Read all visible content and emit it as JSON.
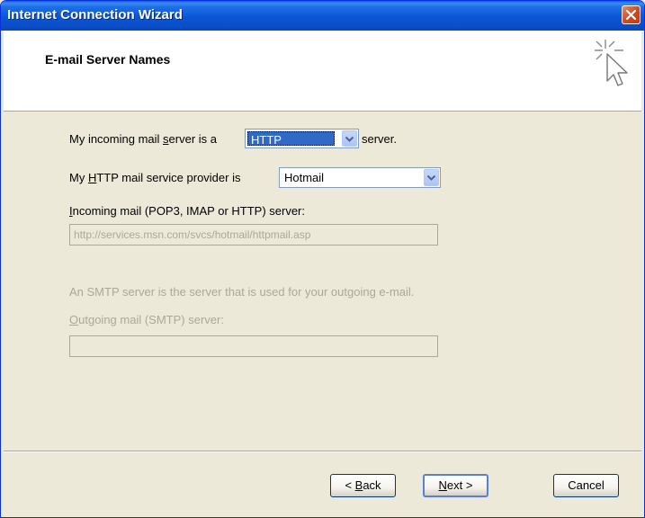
{
  "window": {
    "title": "Internet Connection Wizard"
  },
  "header": {
    "title": "E-mail Server Names"
  },
  "incoming_type": {
    "label_pre": "My incoming mail ",
    "label_ul": "s",
    "label_post": "erver is a",
    "value": "HTTP",
    "suffix": "server."
  },
  "provider": {
    "label_pre": "My ",
    "label_ul": "H",
    "label_post": "TTP mail service provider is",
    "value": "Hotmail"
  },
  "incoming_server": {
    "label_ul": "I",
    "label_post": "ncoming mail (POP3, IMAP or HTTP) server:",
    "value": "http://services.msn.com/svcs/hotmail/httpmail.asp"
  },
  "smtp_note": "An SMTP server is the server that is used for your outgoing e-mail.",
  "outgoing_server": {
    "label_ul": "O",
    "label_post": "utgoing mail (SMTP) server:",
    "value": ""
  },
  "buttons": {
    "back_pre": "< ",
    "back_ul": "B",
    "back_post": "ack",
    "next_ul": "N",
    "next_post": "ext >",
    "cancel": "Cancel"
  },
  "colors": {
    "titlebar": "#0b55d6",
    "close": "#d64a1f",
    "dialog_bg": "#ece9d8",
    "selection": "#316ac5",
    "disabled_text": "#aca899"
  },
  "icons": [
    "close-icon",
    "wizard-cursor-icon",
    "dropdown-arrow-icon"
  ]
}
